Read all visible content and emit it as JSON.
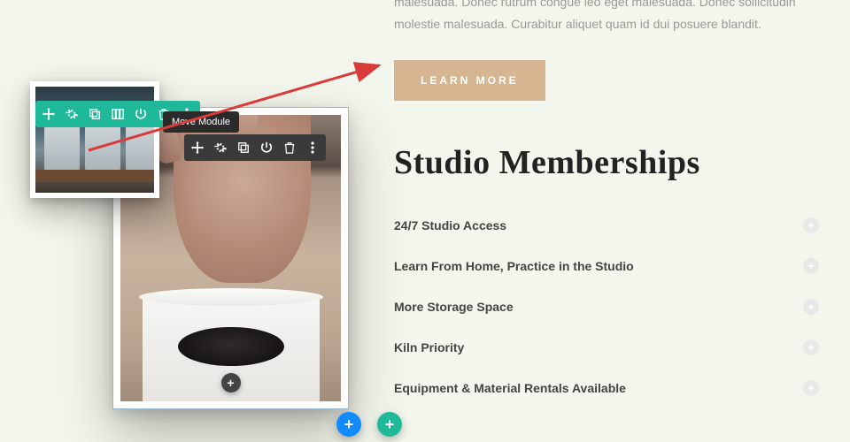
{
  "intro": "malesuada. Donec rutrum congue leo eget malesuada. Donec sollicitudin molestie malesuada. Curabitur aliquet quam id dui posuere blandit.",
  "cta": {
    "label": "LEARN MORE"
  },
  "heading": "Studio Memberships",
  "accordion": [
    {
      "label": "24/7 Studio Access"
    },
    {
      "label": "Learn From Home, Practice in the Studio"
    },
    {
      "label": "More Storage Space"
    },
    {
      "label": "Kiln Priority"
    },
    {
      "label": "Equipment & Material Rentals Available"
    }
  ],
  "tooltip": "Move Module",
  "toolbar_teal": [
    "move",
    "settings",
    "duplicate",
    "columns",
    "power",
    "trash",
    "more"
  ],
  "toolbar_dark": [
    "move",
    "settings",
    "duplicate",
    "power",
    "trash",
    "more"
  ]
}
